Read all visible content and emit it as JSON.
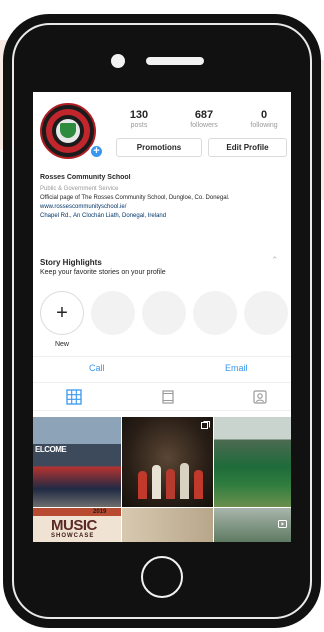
{
  "profile": {
    "stats": [
      {
        "value": "130",
        "label": "posts"
      },
      {
        "value": "687",
        "label": "followers"
      },
      {
        "value": "0",
        "label": "following"
      }
    ],
    "promotions_label": "Promotions",
    "edit_profile_label": "Edit Profile",
    "name": "Rosses Community School",
    "category": "Public & Government Service",
    "description": "Official page of The Rosses Community School, Dungloe, Co. Donegal.",
    "website": "www.rossescommunityschool.ie/",
    "address": "Chapel Rd., An Clochán Liath, Donegal, Ireland"
  },
  "highlights": {
    "title": "Story Highlights",
    "subtitle": "Keep your favorite stories on your profile",
    "new_label": "New"
  },
  "contact": {
    "call_label": "Call",
    "email_label": "Email"
  },
  "grid": {
    "photo1_text": "ELCOME",
    "photo4_year": "2019",
    "photo4_title": "MUSIC",
    "photo4_subtitle": "SHOWCASE"
  },
  "colors": {
    "accent_blue": "#3897f0",
    "link_blue": "#003569",
    "text_dark": "#262626",
    "text_muted": "#999999"
  }
}
